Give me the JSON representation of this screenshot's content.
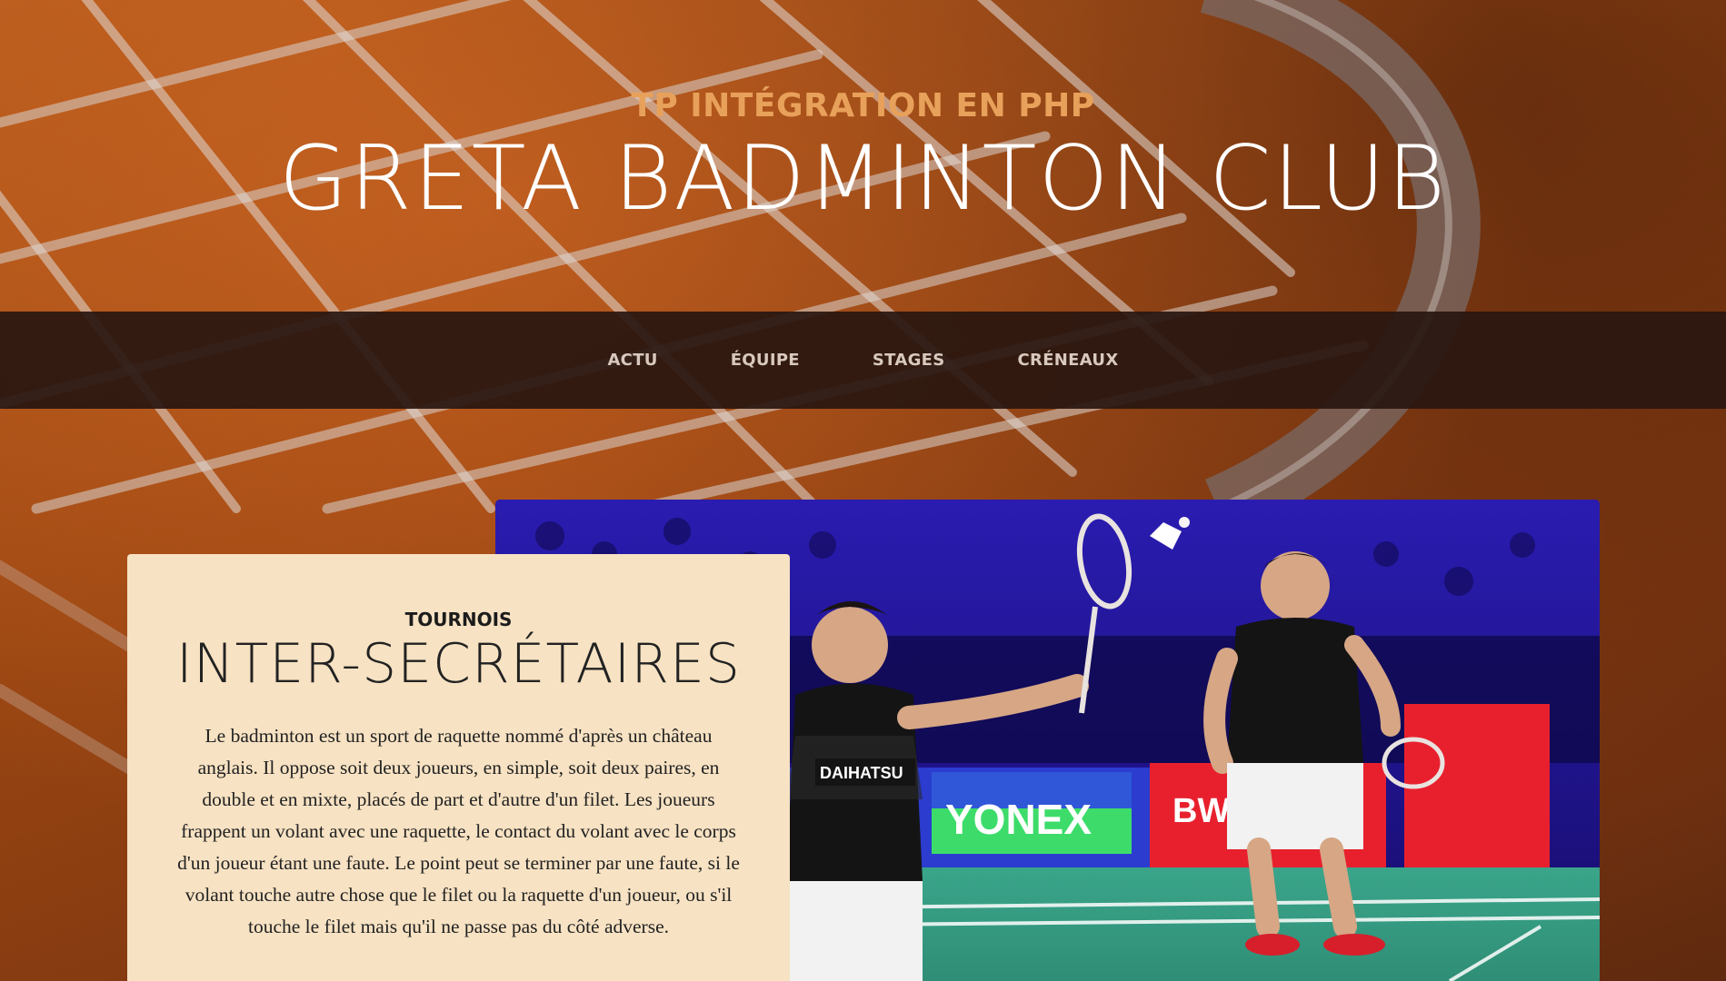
{
  "header": {
    "subtitle": "TP INTÉGRATION EN PHP",
    "title": "GRETA BADMINTON CLUB"
  },
  "nav": {
    "items": [
      {
        "label": "ACTU"
      },
      {
        "label": "ÉQUIPE"
      },
      {
        "label": "STAGES"
      },
      {
        "label": "CRÉNEAUX"
      }
    ]
  },
  "feature": {
    "kicker": "TOURNOIS",
    "heading": "INTER-SECRÉTAIRES",
    "text": "Le badminton est un sport de raquette nommé d'après un château anglais. Il oppose soit deux joueurs, en simple, soit deux paires, en double et en mixte, placés de part et d'autre d'un filet. Les joueurs frappent un volant avec une raquette, le contact du volant avec le corps d'un joueur étant une faute. Le point peut se terminer par une faute, si le volant touche autre chose que le filet ou la raquette d'un joueur, ou s'il touche le filet mais qu'il ne passe pas du côté adverse.",
    "photo": {
      "banner_left": "YONEX",
      "banner_right": "BWF",
      "jersey_text": "DAIHATSU"
    }
  },
  "colors": {
    "accent": "#e8a15a",
    "nav_bg": "#281610",
    "card_bg": "#f7e2c3"
  }
}
